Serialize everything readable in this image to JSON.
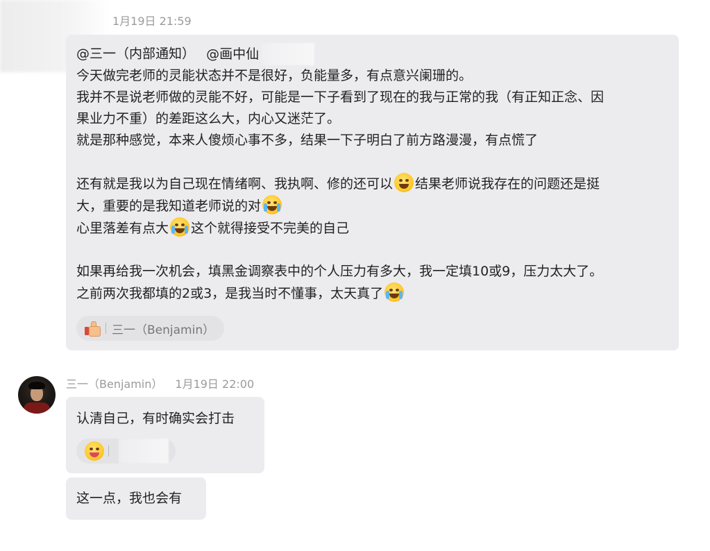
{
  "message1": {
    "timestamp": "1月19日 21:59",
    "mentions": [
      "@三一（内部通知）",
      "@画中仙"
    ],
    "lines": {
      "l1": "今天做完老师的灵能状态并不是很好，负能量多，有点意兴阑珊的。",
      "l2": "我并不是说老师做的灵能不好，可能是一下子看到了现在的我与正常的我（有正知正念、因",
      "l3": "果业力不重）的差距这么大，内心又迷茫了。",
      "l4": "就是那种感觉，本来人傻烦心事不多，结果一下子明白了前方路漫漫，有点慌了",
      "l5a": "还有就是我以为自己现在情绪啊、我执啊、修的还可以",
      "l5b": "结果老师说我存在的问题还是挺",
      "l6": "大，重要的是我知道老师说的对",
      "l7a": "心里落差有点大",
      "l7b": "这个就得接受不完美的自己",
      "l8": "如果再给我一次机会，填黑金调察表中的个人压力有多大，我一定填10或9，压力太大了。",
      "l9": "之前两次我都填的2或3，是我当时不懂事，太天真了"
    },
    "emojis": [
      "smile-icon",
      "cry-laugh-icon",
      "laugh-tears-icon",
      "cry-laugh-icon"
    ],
    "reaction": {
      "icon": "thumbs-up-icon",
      "user": "三一（Benjamin）"
    }
  },
  "message2": {
    "sender": "三一（Benjamin）",
    "timestamp": "1月19日 22:00",
    "text": "认清自己，有时确实会打击",
    "reaction": {
      "icon": "wink-tongue-icon"
    }
  },
  "message3": {
    "text": "这一点，我也会有"
  }
}
